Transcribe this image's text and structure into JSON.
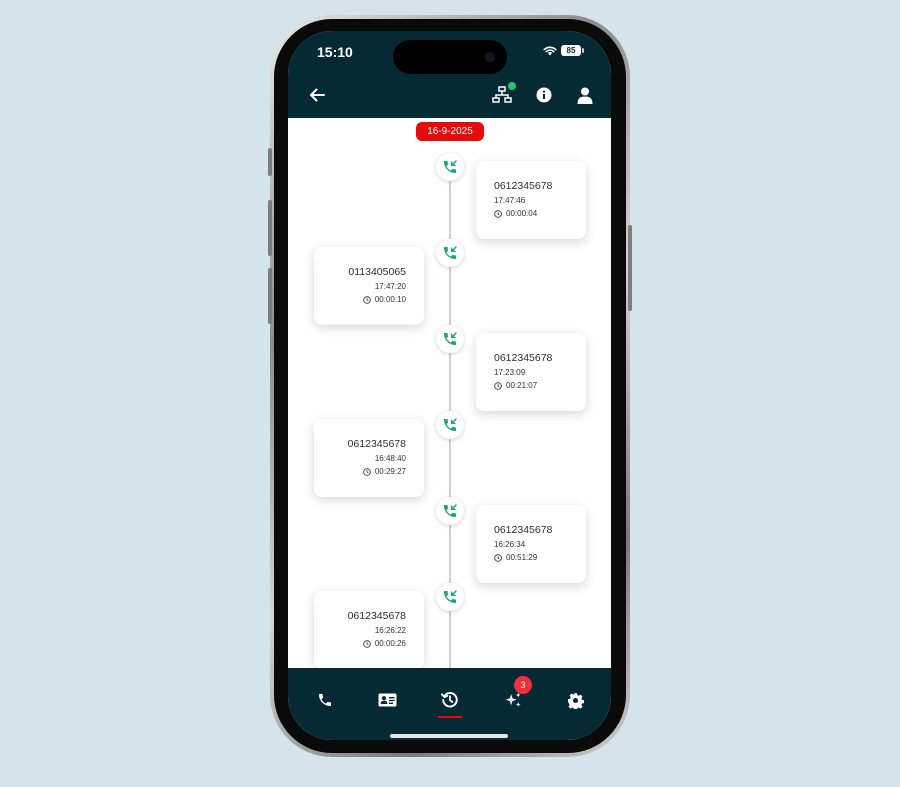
{
  "status_bar": {
    "time": "15:10",
    "battery": "85"
  },
  "header": {
    "back_icon": "arrow-left-icon",
    "network_icon": "network-icon",
    "info_icon": "info-icon",
    "profile_icon": "user-icon"
  },
  "timeline": {
    "date": "16-9-2025",
    "calls": [
      {
        "number": "0612345678",
        "time": "17:47:46",
        "duration": "00:00:04",
        "side": "right",
        "icon": "incoming-call-icon"
      },
      {
        "number": "0113405065",
        "time": "17:47:20",
        "duration": "00:00:10",
        "side": "left",
        "icon": "incoming-call-icon"
      },
      {
        "number": "0612345678",
        "time": "17:23:09",
        "duration": "00:21:07",
        "side": "right",
        "icon": "incoming-call-icon"
      },
      {
        "number": "0612345678",
        "time": "16:48:40",
        "duration": "00:29:27",
        "side": "left",
        "icon": "incoming-call-icon"
      },
      {
        "number": "0612345678",
        "time": "16:26:34",
        "duration": "00:51:29",
        "side": "right",
        "icon": "incoming-call-icon"
      },
      {
        "number": "0612345678",
        "time": "16:26:22",
        "duration": "00:00:26",
        "side": "left",
        "icon": "incoming-call-icon"
      }
    ]
  },
  "bottom_nav": {
    "items": [
      {
        "icon": "phone-icon",
        "active": false
      },
      {
        "icon": "contact-card-icon",
        "active": false
      },
      {
        "icon": "history-icon",
        "active": true
      },
      {
        "icon": "sparkles-icon",
        "active": false,
        "badge": "3"
      },
      {
        "icon": "gear-icon",
        "active": false
      }
    ]
  },
  "colors": {
    "header_bg": "#062a33",
    "accent_red": "#e30b0b",
    "call_green": "#1aa676",
    "badge_red": "#ef2f3c"
  }
}
